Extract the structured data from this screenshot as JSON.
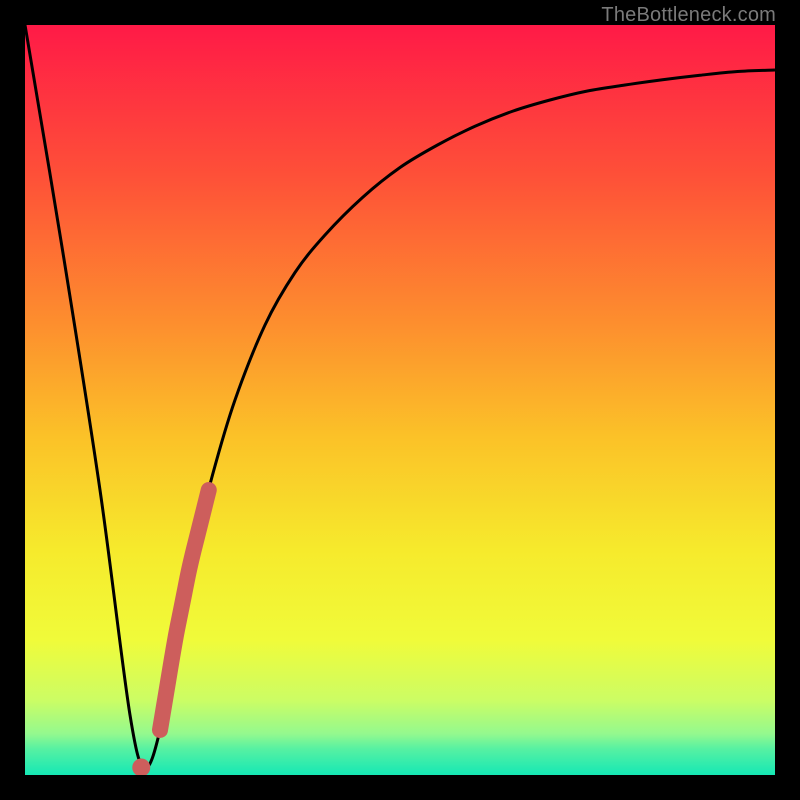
{
  "attribution": "TheBottleneck.com",
  "colors": {
    "frame": "#000000",
    "curve": "#000000",
    "marker": "#cd5e5c",
    "gradient_stops": [
      {
        "pos": 0.0,
        "color": "#ff1a47"
      },
      {
        "pos": 0.2,
        "color": "#fe5038"
      },
      {
        "pos": 0.4,
        "color": "#fd8f2e"
      },
      {
        "pos": 0.55,
        "color": "#fbc228"
      },
      {
        "pos": 0.7,
        "color": "#f6ea2c"
      },
      {
        "pos": 0.82,
        "color": "#f0fb3a"
      },
      {
        "pos": 0.9,
        "color": "#ccfd64"
      },
      {
        "pos": 0.945,
        "color": "#94f98e"
      },
      {
        "pos": 0.965,
        "color": "#57f1a2"
      },
      {
        "pos": 1.0,
        "color": "#15e8b5"
      }
    ]
  },
  "chart_data": {
    "type": "line",
    "title": "",
    "xlabel": "",
    "ylabel": "",
    "xlim": [
      0,
      100
    ],
    "ylim": [
      0,
      100
    ],
    "series": [
      {
        "name": "bottleneck-curve",
        "x": [
          0,
          5,
          10,
          14,
          16,
          18,
          20,
          22,
          25,
          28,
          32,
          36,
          40,
          45,
          50,
          55,
          60,
          65,
          70,
          75,
          80,
          85,
          90,
          95,
          100
        ],
        "y": [
          100,
          70,
          38,
          8,
          1,
          6,
          18,
          28,
          40,
          50,
          60,
          67,
          72,
          77,
          81,
          84,
          86.5,
          88.5,
          90,
          91.2,
          92,
          92.7,
          93.3,
          93.8,
          94
        ]
      }
    ],
    "markers": [
      {
        "name": "highlight-segment",
        "x_start": 18,
        "x_end": 24.5,
        "note": "thick marker band along curve"
      },
      {
        "name": "minimum-dot",
        "x": 15.5,
        "y": 1
      }
    ]
  }
}
